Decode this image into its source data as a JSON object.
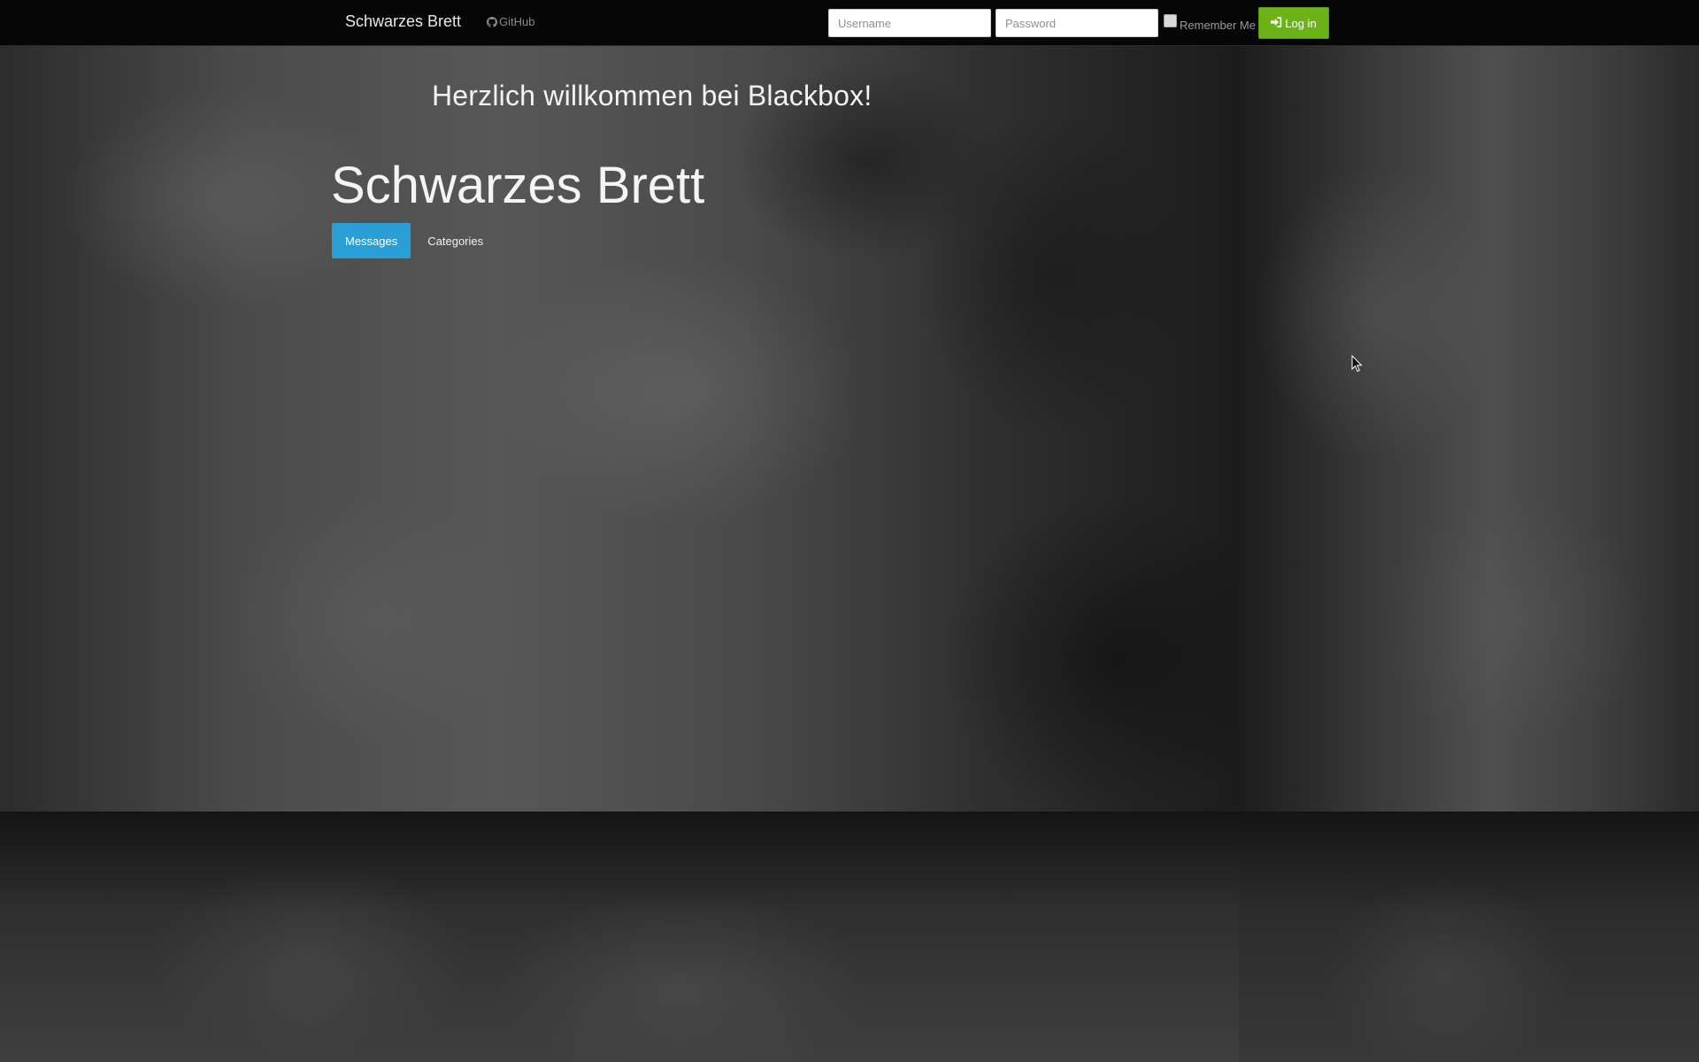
{
  "navbar": {
    "brand": "Schwarzes Brett",
    "github_label": "GitHub",
    "username_placeholder": "Username",
    "password_placeholder": "Password",
    "remember_label": "Remember Me",
    "login_label": "Log in",
    "login_color": "#6cb318"
  },
  "main": {
    "welcome": "Herzlich willkommen bei Blackbox!",
    "title": "Schwarzes Brett",
    "tabs": [
      {
        "label": "Messages",
        "active": true
      },
      {
        "label": "Categories",
        "active": false
      }
    ],
    "active_tab_color": "#2a9fd6"
  },
  "icons": {
    "github": "github-icon",
    "login": "sign-in-icon"
  }
}
